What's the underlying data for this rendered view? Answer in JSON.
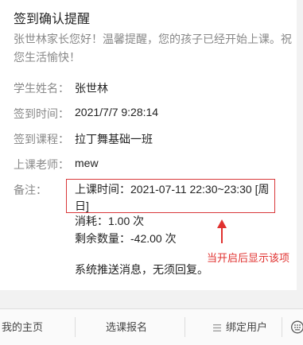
{
  "message": {
    "title": "签到确认提醒",
    "intro": "张世林家长您好！温馨提醒，您的孩子已经开始上课。祝您生活愉快！",
    "fields": [
      {
        "label": "学生姓名：",
        "value": "张世林"
      },
      {
        "label": "签到时间：",
        "value": "2021/7/7 9:28:14"
      },
      {
        "label": "签到课程：",
        "value": "拉丁舞基础一班"
      },
      {
        "label": "上课老师：",
        "value": "mew"
      }
    ],
    "remark": {
      "label": "备注：",
      "class_time": "上课时间：2021-07-11 22:30~23:30 [周日]",
      "consumed": "消耗：1.00 次",
      "remaining": "剩余数量：-42.00 次",
      "system_note": "系统推送消息，无须回复。"
    }
  },
  "annotation": {
    "text": "当开启后显示该项",
    "color": "#e0312f"
  },
  "footer": {
    "tabs": [
      "我的主页",
      "选课报名",
      "绑定用户"
    ],
    "icons": [
      "menu-icon",
      "keyboard-icon"
    ]
  }
}
